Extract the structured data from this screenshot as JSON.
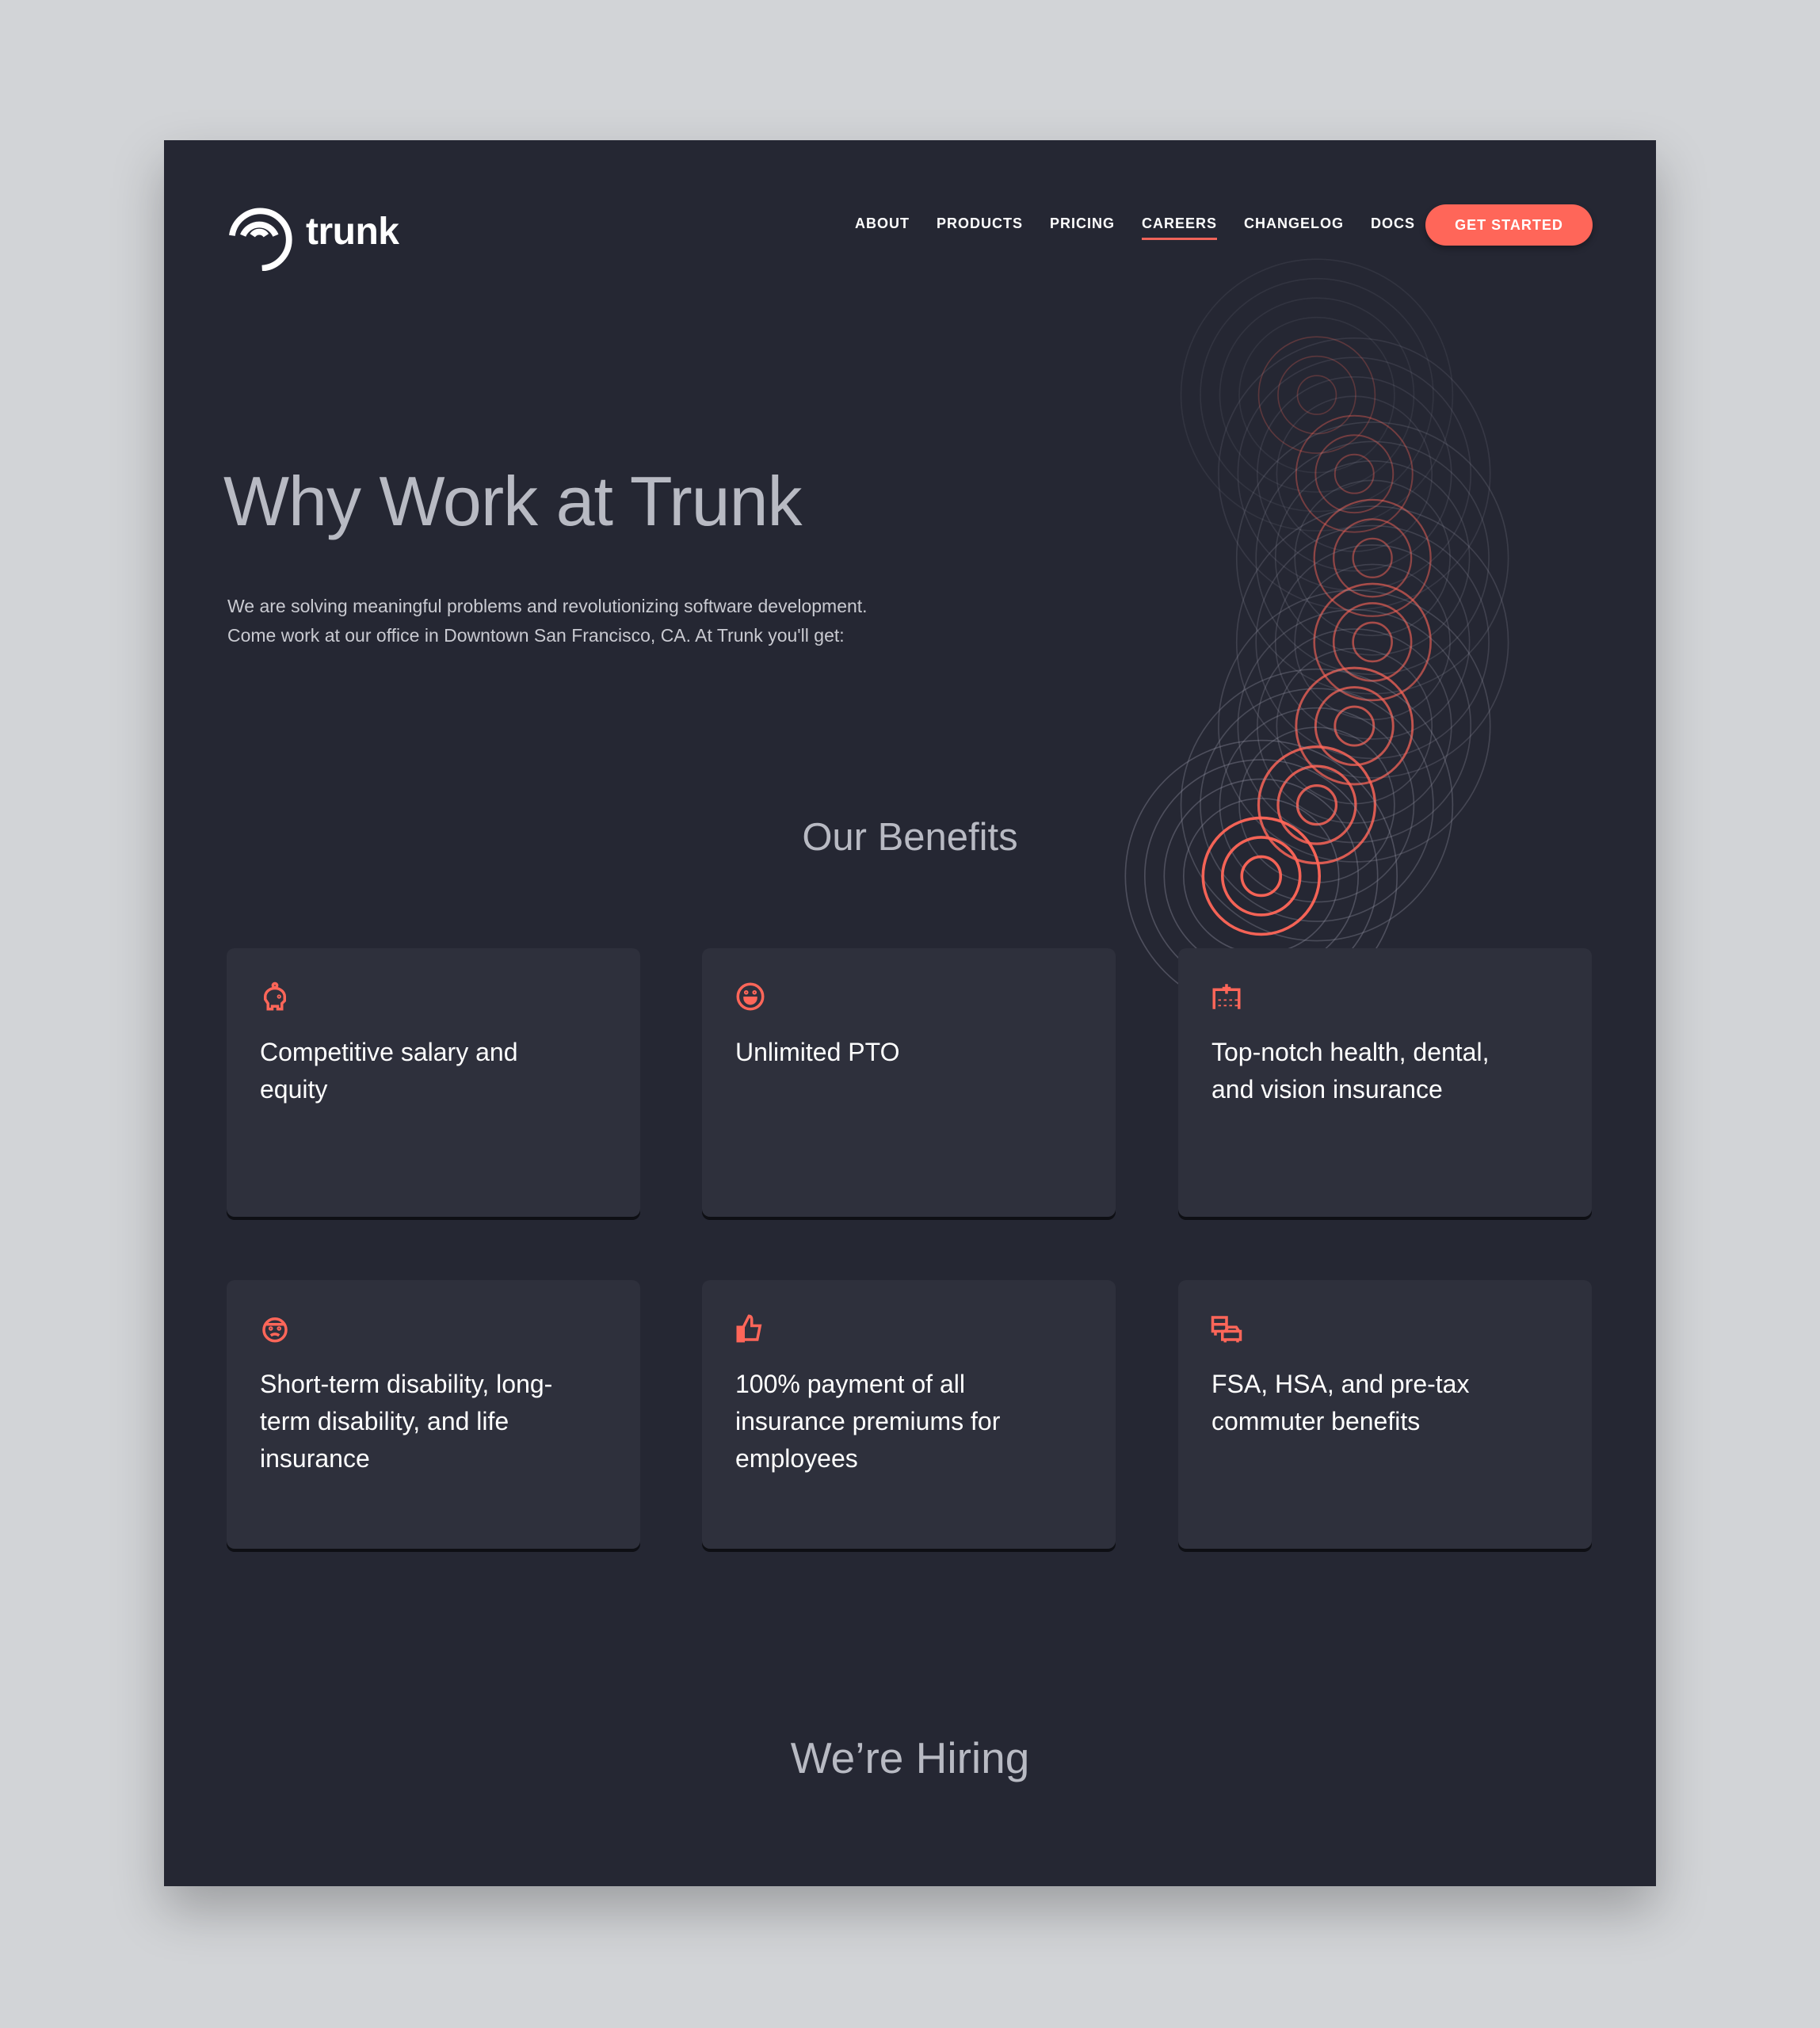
{
  "brand": {
    "name": "trunk",
    "accent": "#ff6659"
  },
  "nav": {
    "items": [
      {
        "label": "ABOUT"
      },
      {
        "label": "PRODUCTS"
      },
      {
        "label": "PRICING"
      },
      {
        "label": "CAREERS",
        "active": true
      },
      {
        "label": "CHANGELOG"
      },
      {
        "label": "DOCS"
      }
    ],
    "cta": "GET STARTED"
  },
  "hero": {
    "title": "Why Work at Trunk",
    "intro_line1": "We are solving meaningful problems and revolutionizing software development.",
    "intro_line2": "Come work at our office in Downtown San Francisco, CA. At Trunk you'll get:"
  },
  "benefits": {
    "heading": "Our Benefits",
    "items": [
      {
        "icon": "piggy-bank-icon",
        "text": "Competitive salary and equity"
      },
      {
        "icon": "smiley-icon",
        "text": "Unlimited PTO"
      },
      {
        "icon": "hospital-icon",
        "text": "Top-notch health, dental, and vision insurance"
      },
      {
        "icon": "sick-face-icon",
        "text": "Short-term disability, long-term disability, and life insurance"
      },
      {
        "icon": "thumbs-up-icon",
        "text": "100% payment of all insurance premiums for employees"
      },
      {
        "icon": "commute-icon",
        "text": "FSA, HSA, and pre-tax commuter benefits"
      }
    ]
  },
  "hiring": {
    "heading": "We’re Hiring"
  }
}
